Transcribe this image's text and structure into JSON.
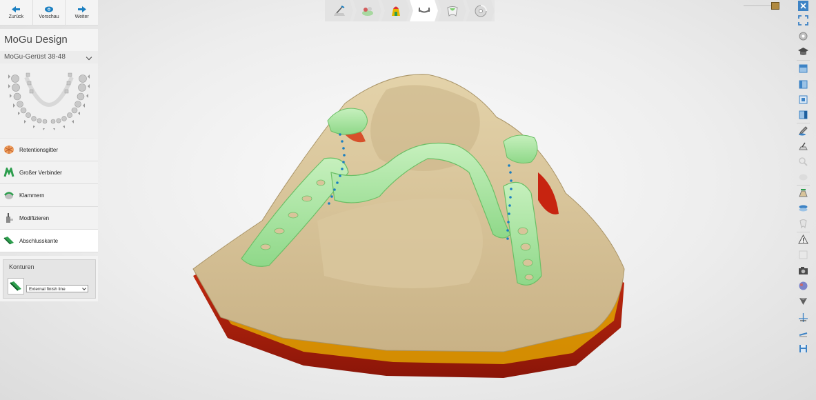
{
  "nav": {
    "back_label": "Zurück",
    "preview_label": "Vorschau",
    "next_label": "Weiter"
  },
  "app_title": "MoGu Design",
  "framework_select": "MoGu-Gerüst 38-48",
  "steps": [
    {
      "label": "Retentionsgitter",
      "icon": "retention-grid-icon"
    },
    {
      "label": "Großer Verbinder",
      "icon": "major-connector-icon"
    },
    {
      "label": "Klammern",
      "icon": "clasp-icon"
    },
    {
      "label": "Modifizieren",
      "icon": "modify-icon"
    },
    {
      "label": "Abschlusskante",
      "icon": "finish-line-icon"
    }
  ],
  "contours": {
    "title": "Konturen",
    "select_value": "External finish line"
  },
  "top_toolbar": [
    {
      "icon": "prepare-model-icon",
      "active": false
    },
    {
      "icon": "survey-icon",
      "active": false
    },
    {
      "icon": "blockout-icon",
      "active": false
    },
    {
      "icon": "framework-design-icon",
      "active": true
    },
    {
      "icon": "tooth-setup-icon",
      "active": false
    },
    {
      "icon": "export-disc-icon",
      "active": false
    }
  ],
  "colors": {
    "accent_blue": "#1a7fc1",
    "gum_tan": "#d8c49a",
    "framework_green": "#a9e6a3",
    "undercut_red": "#b01c10",
    "undercut_yellow": "#e5c200"
  }
}
